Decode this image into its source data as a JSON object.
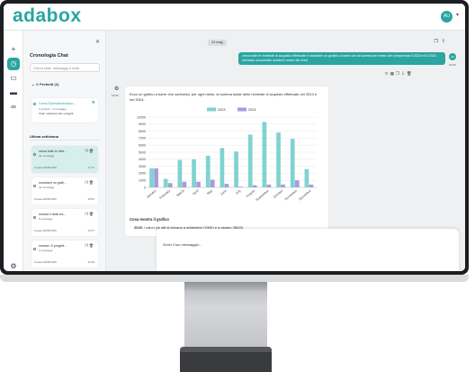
{
  "app": {
    "logo": "adabox",
    "user_initials": "AU"
  },
  "sidebar": {
    "title": "Cronologia Chat",
    "search_placeholder": "Cerca chat, messaggi o note",
    "favorites": {
      "header": "Preferiti (1)",
      "item": {
        "name": "Cerca Dipendente/Asso...",
        "sub": "1 preferiti · 4 messaggi",
        "desc": "Chat: mostrami tutti i progetti"
      }
    },
    "section_label": "Ultima settimana",
    "chats": [
      {
        "title": "cerca tutte le richi...",
        "count": "34 messaggi",
        "date": "Creata 07/05/2025",
        "time": "17:17",
        "active": true
      },
      {
        "title": "mostrami un grafi...",
        "count": "42 messaggi",
        "date": "Creata 04/05/2025",
        "time": "18:54",
        "active": false
      },
      {
        "title": "mostra il della tra...",
        "count": "6 messaggi",
        "date": "Creata 04/05/2025",
        "time": "13:57",
        "active": false
      },
      {
        "title": "mostra i 5 progett...",
        "count": "2 messaggi",
        "date": "Creata 04/05/2025",
        "time": "16:29",
        "active": false
      }
    ]
  },
  "main": {
    "date_badge": "24 mag",
    "user_message": "cerca tutte le richieste di acquisto effettuate e mostrami un grafico a barre con la somma per mese che comprenda il 2023 ed il 2024. nell'asse orizzontale mostra il nome dei mesi",
    "user_time": "16:50",
    "bot_time": "16:50",
    "bot_intro": "Ecco un grafico a barre che confronta, per ogni mese, la somma totale delle richieste di acquisto effettuate nel 2023 e nel 2024:",
    "analysis_title": "Cosa mostra il grafico",
    "analysis_point_year": "2023",
    "analysis_point_text": ": i valori più alti si trovano a settembre (9300) e a giugno (5600).",
    "input_placeholder": "Scrivi il tuo messaggio..."
  },
  "chart_data": {
    "type": "bar",
    "categories": [
      "January",
      "February",
      "March",
      "April",
      "May",
      "June",
      "July",
      "August",
      "September",
      "October",
      "November",
      "December"
    ],
    "series": [
      {
        "name": "2023",
        "values": [
          2700,
          1200,
          3900,
          4000,
          4500,
          5600,
          5100,
          7500,
          9300,
          7800,
          6900,
          2600
        ],
        "color": "#7fd3d0"
      },
      {
        "name": "2024",
        "values": [
          2700,
          600,
          800,
          800,
          1100,
          500,
          100,
          300,
          400,
          400,
          1000,
          400
        ],
        "color": "#a99bd6"
      }
    ],
    "ylim": [
      0,
      10000
    ],
    "yticks": [
      0,
      1000,
      2000,
      3000,
      4000,
      5000,
      6000,
      7000,
      8000,
      9000,
      10000
    ],
    "grid": true,
    "legend": "top-center"
  }
}
